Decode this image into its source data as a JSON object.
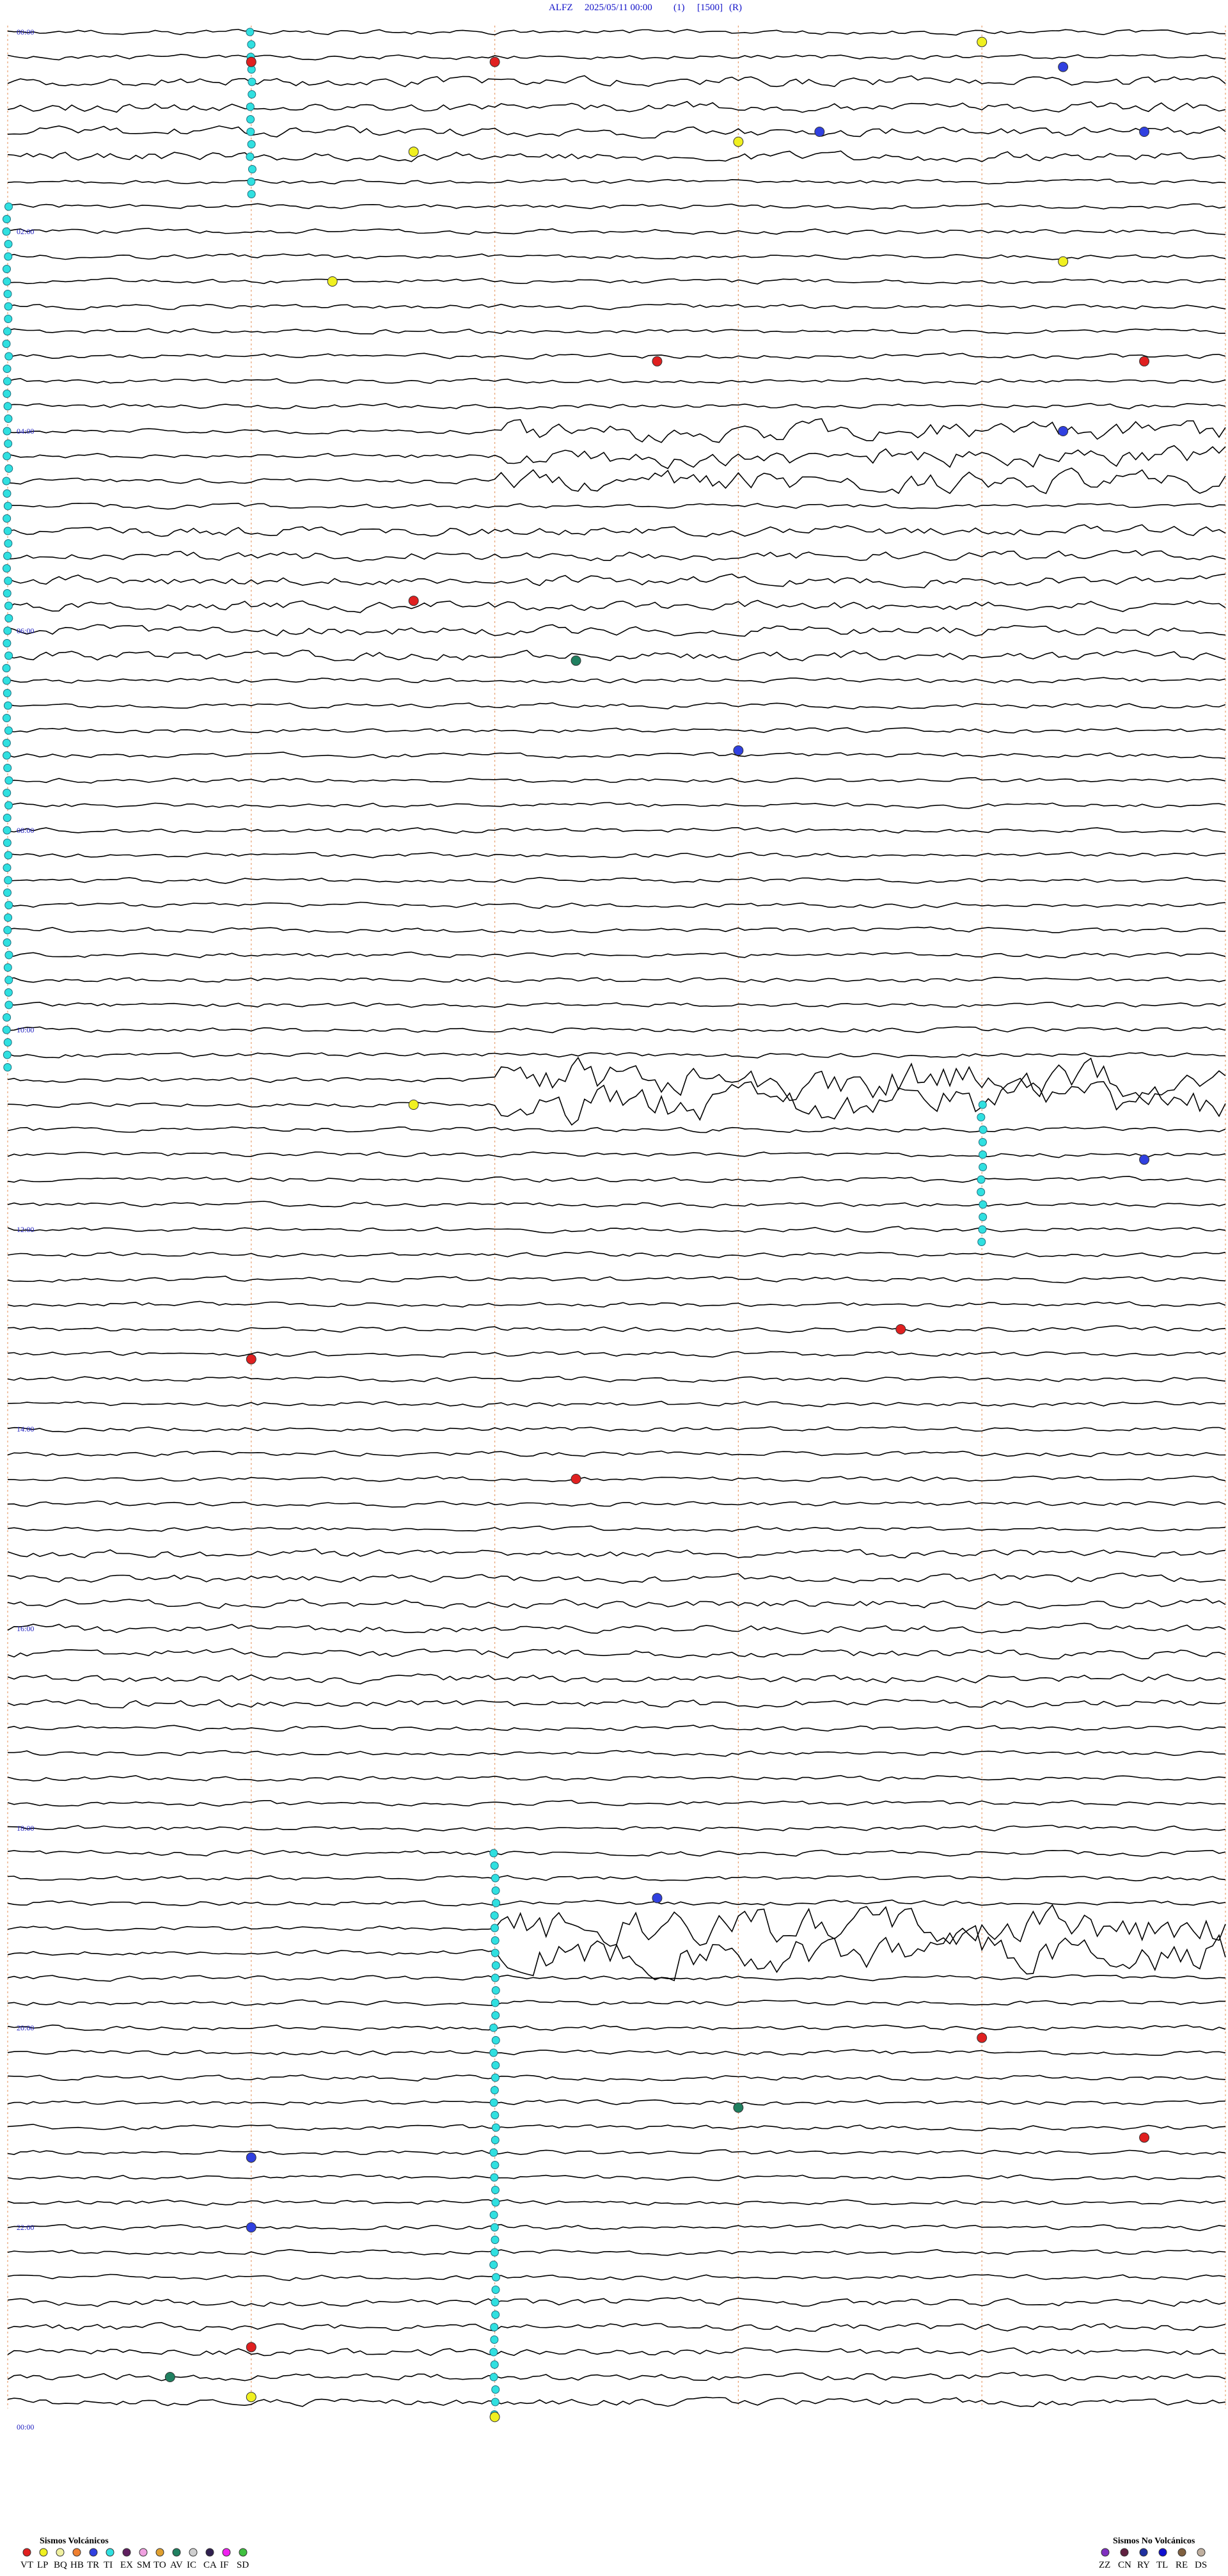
{
  "header": {
    "station": "ALFZ",
    "datetime": "2025/05/11 00:00",
    "component": "(1)",
    "scale": "[1500]",
    "mode": "(R)"
  },
  "chart_data": {
    "type": "helicorder",
    "station": "ALFZ",
    "start": "2025/05/11 00:00",
    "traces_per_hour": 4,
    "minutes_per_trace": 15,
    "time_labels": [
      "00:00",
      "02:00",
      "04:00",
      "06:00",
      "08:00",
      "10:00",
      "12:00",
      "14:00",
      "16:00",
      "18:00",
      "20:00",
      "22:00",
      "00:00"
    ],
    "colors": {
      "trace": "#000000",
      "minute_grid": "#e8a070",
      "time_label": "#2020c0",
      "header": "#1010c8"
    },
    "legend": {
      "volcanic": {
        "title": "Sismos Volcánicos",
        "items": [
          {
            "code": "VT",
            "color": "#e02020"
          },
          {
            "code": "LP",
            "color": "#f0f020"
          },
          {
            "code": "BQ",
            "color": "#f0f0a0"
          },
          {
            "code": "HB",
            "color": "#f08030"
          },
          {
            "code": "TR",
            "color": "#3040e0"
          },
          {
            "code": "TI",
            "color": "#30e0e0"
          },
          {
            "code": "EX",
            "color": "#602060"
          },
          {
            "code": "SM",
            "color": "#f0a0e0"
          },
          {
            "code": "TO",
            "color": "#e0a030"
          },
          {
            "code": "AV",
            "color": "#208060"
          },
          {
            "code": "IC",
            "color": "#d0d0d0"
          },
          {
            "code": "CA",
            "color": "#302050"
          },
          {
            "code": "IF",
            "color": "#f020f0"
          },
          {
            "code": "SD",
            "color": "#40c040"
          }
        ]
      },
      "non_volcanic": {
        "title": "Sismos No Volcánicos",
        "items": [
          {
            "code": "ZZ",
            "color": "#8030c0"
          },
          {
            "code": "CN",
            "color": "#602040"
          },
          {
            "code": "RY",
            "color": "#2030a0"
          },
          {
            "code": "TL",
            "color": "#1010d0"
          },
          {
            "code": "RE",
            "color": "#806040"
          },
          {
            "code": "DS",
            "color": "#c0b0a0"
          }
        ]
      }
    },
    "bursts": [
      {
        "start_hour": 10.55,
        "end_hour": 10.85,
        "level": "high",
        "label": "tremor"
      },
      {
        "start_hour": 4.1,
        "end_hour": 4.5,
        "level": "medium",
        "label": "tremor"
      },
      {
        "start_hour": 19.0,
        "end_hour": 19.4,
        "level": "high",
        "label": "tremor"
      }
    ],
    "events": [
      {
        "hour": 0.3,
        "minute": 3,
        "type": "VT"
      },
      {
        "hour": 0.3,
        "minute": 6,
        "type": "VT"
      },
      {
        "hour": 0.1,
        "minute": 12,
        "type": "LP"
      },
      {
        "hour": 0.35,
        "minute": 13,
        "type": "TR"
      },
      {
        "hour": 1.0,
        "minute": 10,
        "type": "TR"
      },
      {
        "hour": 1.0,
        "minute": 14,
        "type": "TR"
      },
      {
        "hour": 1.2,
        "minute": 5,
        "type": "LP"
      },
      {
        "hour": 1.1,
        "minute": 9,
        "type": "LP"
      },
      {
        "hour": 2.3,
        "minute": 13,
        "type": "LP"
      },
      {
        "hour": 2.5,
        "minute": 4,
        "type": "LP"
      },
      {
        "hour": 3.3,
        "minute": 8,
        "type": "VT"
      },
      {
        "hour": 3.3,
        "minute": 14,
        "type": "VT"
      },
      {
        "hour": 4.0,
        "minute": 13,
        "type": "TR"
      },
      {
        "hour": 5.7,
        "minute": 5,
        "type": "VT"
      },
      {
        "hour": 6.3,
        "minute": 7,
        "type": "AV"
      },
      {
        "hour": 7.2,
        "minute": 9,
        "type": "TR"
      },
      {
        "hour": 10.75,
        "minute": 5,
        "type": "LP"
      },
      {
        "hour": 11.3,
        "minute": 14,
        "type": "TR"
      },
      {
        "hour": 13.3,
        "minute": 3,
        "type": "VT"
      },
      {
        "hour": 13.0,
        "minute": 11,
        "type": "VT"
      },
      {
        "hour": 14.5,
        "minute": 7,
        "type": "VT"
      },
      {
        "hour": 18.7,
        "minute": 8,
        "type": "TR"
      },
      {
        "hour": 20.1,
        "minute": 12,
        "type": "VT"
      },
      {
        "hour": 20.8,
        "minute": 9,
        "type": "AV"
      },
      {
        "hour": 21.1,
        "minute": 14,
        "type": "VT"
      },
      {
        "hour": 21.3,
        "minute": 3,
        "type": "TR"
      },
      {
        "hour": 22.0,
        "minute": 3,
        "type": "TR"
      },
      {
        "hour": 23.2,
        "minute": 3,
        "type": "VT"
      },
      {
        "hour": 23.5,
        "minute": 2,
        "type": "AV"
      },
      {
        "hour": 23.7,
        "minute": 3,
        "type": "LP"
      },
      {
        "hour": 23.9,
        "minute": 6,
        "type": "LP"
      }
    ],
    "cyan_columns": [
      {
        "minute": 3,
        "start_hour": 0.0,
        "end_hour": 1.5
      },
      {
        "minute": 0,
        "start_hour": 1.8,
        "end_hour": 10.2
      },
      {
        "minute": 12,
        "start_hour": 10.8,
        "end_hour": 12.0
      },
      {
        "minute": 6,
        "start_hour": 18.2,
        "end_hour": 24.0
      }
    ]
  }
}
